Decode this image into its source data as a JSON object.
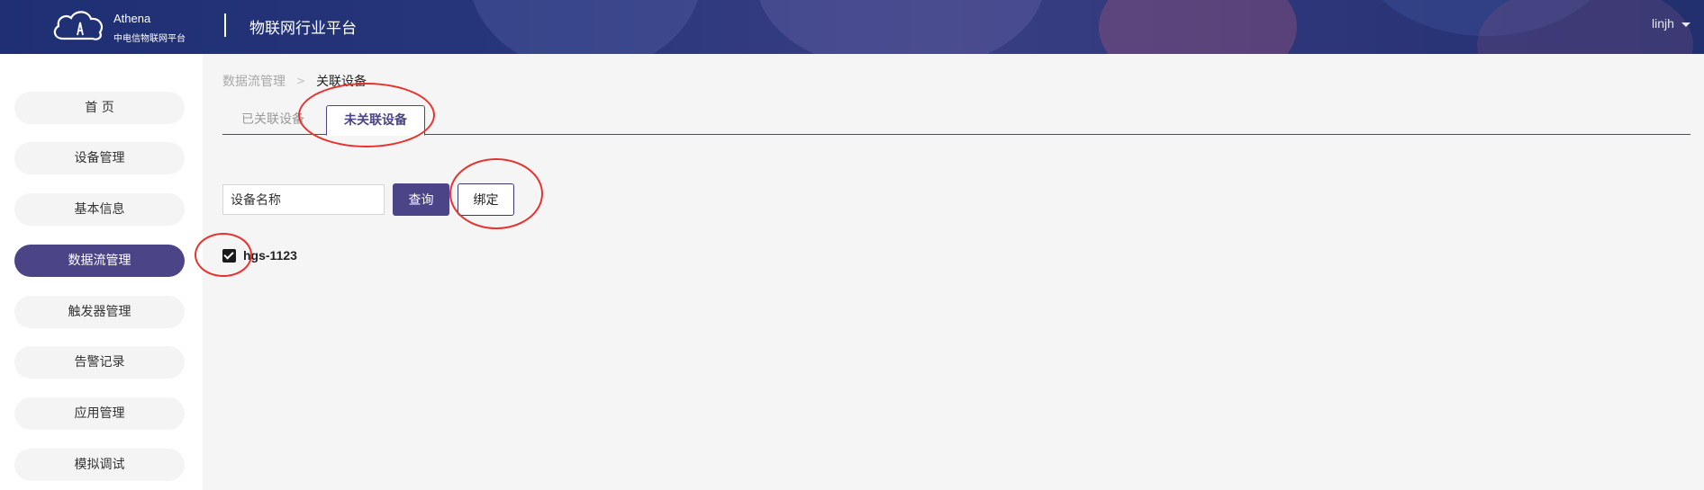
{
  "header": {
    "logo_name": "Athena",
    "logo_subtitle": "中电信物联网平台",
    "platform_title": "物联网行业平台",
    "user": "linjh"
  },
  "sidebar": {
    "items": [
      {
        "label": "首 页",
        "active": false
      },
      {
        "label": "设备管理",
        "active": false
      },
      {
        "label": "基本信息",
        "active": false
      },
      {
        "label": "数据流管理",
        "active": true
      },
      {
        "label": "触发器管理",
        "active": false
      },
      {
        "label": "告警记录",
        "active": false
      },
      {
        "label": "应用管理",
        "active": false
      },
      {
        "label": "模拟调试",
        "active": false
      }
    ]
  },
  "breadcrumb": {
    "parent": "数据流管理",
    "separator": ">",
    "current": "关联设备"
  },
  "tabs": {
    "linked": "已关联设备",
    "unlinked": "未关联设备",
    "active": "unlinked"
  },
  "filter": {
    "device_name_value": "设备名称",
    "query_label": "查询",
    "bind_label": "绑定"
  },
  "devices": [
    {
      "name": "hgs-1123",
      "checked": true
    }
  ],
  "colors": {
    "accent": "#4b4588",
    "header_bg": "#27357a",
    "annotation": "#e8322e"
  }
}
